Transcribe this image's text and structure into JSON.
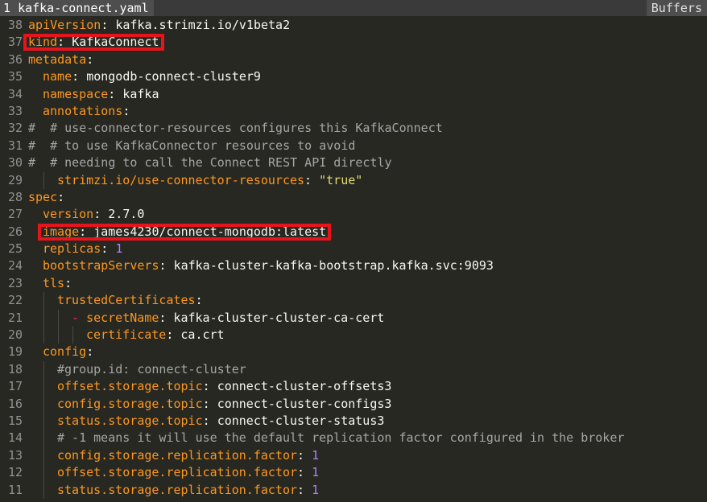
{
  "tabline": {
    "tab_number": "1",
    "tab_filename": "kafka-connect.yaml",
    "right_label": "Buffers"
  },
  "lines": [
    {
      "num": "38",
      "indent": 0,
      "guides": 0,
      "parts": [
        {
          "t": "key",
          "s": "apiVersion"
        },
        {
          "t": "punct",
          "s": ": "
        },
        {
          "t": "val",
          "s": "kafka.strimzi.io/v1beta2"
        }
      ]
    },
    {
      "num": "37",
      "indent": 0,
      "guides": 0,
      "parts": [
        {
          "t": "key",
          "s": "kind"
        },
        {
          "t": "punct",
          "s": ": "
        },
        {
          "t": "val",
          "s": "KafkaConnect"
        }
      ]
    },
    {
      "num": "36",
      "indent": 0,
      "guides": 0,
      "parts": [
        {
          "t": "key",
          "s": "metadata"
        },
        {
          "t": "punct",
          "s": ":"
        }
      ]
    },
    {
      "num": "35",
      "indent": 1,
      "guides": 0,
      "parts": [
        {
          "t": "key",
          "s": "name"
        },
        {
          "t": "punct",
          "s": ": "
        },
        {
          "t": "val",
          "s": "mongodb-connect-cluster9"
        }
      ]
    },
    {
      "num": "34",
      "indent": 1,
      "guides": 0,
      "parts": [
        {
          "t": "key",
          "s": "namespace"
        },
        {
          "t": "punct",
          "s": ": "
        },
        {
          "t": "val",
          "s": "kafka"
        }
      ]
    },
    {
      "num": "33",
      "indent": 1,
      "guides": 0,
      "parts": [
        {
          "t": "key",
          "s": "annotations"
        },
        {
          "t": "punct",
          "s": ":"
        }
      ]
    },
    {
      "num": "32",
      "indent": 0,
      "guides": 0,
      "parts": [
        {
          "t": "cmt",
          "s": "#  # use-connector-resources configures this KafkaConnect"
        }
      ]
    },
    {
      "num": "31",
      "indent": 0,
      "guides": 0,
      "parts": [
        {
          "t": "cmt",
          "s": "#  # to use KafkaConnector resources to avoid"
        }
      ]
    },
    {
      "num": "30",
      "indent": 0,
      "guides": 0,
      "parts": [
        {
          "t": "cmt",
          "s": "#  # needing to call the Connect REST API directly"
        }
      ]
    },
    {
      "num": "29",
      "indent": 2,
      "guides": 1,
      "parts": [
        {
          "t": "key",
          "s": "strimzi.io/use-connector-resources"
        },
        {
          "t": "punct",
          "s": ": "
        },
        {
          "t": "str",
          "s": "\"true\""
        }
      ]
    },
    {
      "num": "28",
      "indent": 0,
      "guides": 0,
      "parts": [
        {
          "t": "key",
          "s": "spec"
        },
        {
          "t": "punct",
          "s": ":"
        }
      ]
    },
    {
      "num": "27",
      "indent": 1,
      "guides": 0,
      "parts": [
        {
          "t": "key",
          "s": "version"
        },
        {
          "t": "punct",
          "s": ": "
        },
        {
          "t": "val",
          "s": "2.7.0"
        }
      ]
    },
    {
      "num": "26",
      "indent": 1,
      "guides": 0,
      "parts": [
        {
          "t": "key",
          "s": "image"
        },
        {
          "t": "punct",
          "s": ": "
        },
        {
          "t": "val",
          "s": "james4230/connect-mongodb:latest"
        }
      ]
    },
    {
      "num": "25",
      "indent": 1,
      "guides": 0,
      "parts": [
        {
          "t": "key",
          "s": "replicas"
        },
        {
          "t": "punct",
          "s": ": "
        },
        {
          "t": "num",
          "s": "1"
        }
      ]
    },
    {
      "num": "24",
      "indent": 1,
      "guides": 0,
      "parts": [
        {
          "t": "key",
          "s": "bootstrapServers"
        },
        {
          "t": "punct",
          "s": ": "
        },
        {
          "t": "val",
          "s": "kafka-cluster-kafka-bootstrap.kafka.svc:9093"
        }
      ]
    },
    {
      "num": "23",
      "indent": 1,
      "guides": 0,
      "parts": [
        {
          "t": "key",
          "s": "tls"
        },
        {
          "t": "punct",
          "s": ":"
        }
      ]
    },
    {
      "num": "22",
      "indent": 2,
      "guides": 1,
      "parts": [
        {
          "t": "key",
          "s": "trustedCertificates"
        },
        {
          "t": "punct",
          "s": ":"
        }
      ]
    },
    {
      "num": "21",
      "indent": 3,
      "guides": 2,
      "parts": [
        {
          "t": "dash",
          "s": "- "
        },
        {
          "t": "key",
          "s": "secretName"
        },
        {
          "t": "punct",
          "s": ": "
        },
        {
          "t": "val",
          "s": "kafka-cluster-cluster-ca-cert"
        }
      ]
    },
    {
      "num": "20",
      "indent": 4,
      "guides": 3,
      "parts": [
        {
          "t": "key",
          "s": "certificate"
        },
        {
          "t": "punct",
          "s": ": "
        },
        {
          "t": "val",
          "s": "ca.crt"
        }
      ]
    },
    {
      "num": "19",
      "indent": 1,
      "guides": 0,
      "parts": [
        {
          "t": "key",
          "s": "config"
        },
        {
          "t": "punct",
          "s": ":"
        }
      ]
    },
    {
      "num": "18",
      "indent": 2,
      "guides": 1,
      "parts": [
        {
          "t": "cmt",
          "s": "#group.id: connect-cluster"
        }
      ]
    },
    {
      "num": "17",
      "indent": 2,
      "guides": 1,
      "parts": [
        {
          "t": "key",
          "s": "offset.storage.topic"
        },
        {
          "t": "punct",
          "s": ": "
        },
        {
          "t": "val",
          "s": "connect-cluster-offsets3"
        }
      ]
    },
    {
      "num": "16",
      "indent": 2,
      "guides": 1,
      "parts": [
        {
          "t": "key",
          "s": "config.storage.topic"
        },
        {
          "t": "punct",
          "s": ": "
        },
        {
          "t": "val",
          "s": "connect-cluster-configs3"
        }
      ]
    },
    {
      "num": "15",
      "indent": 2,
      "guides": 1,
      "parts": [
        {
          "t": "key",
          "s": "status.storage.topic"
        },
        {
          "t": "punct",
          "s": ": "
        },
        {
          "t": "val",
          "s": "connect-cluster-status3"
        }
      ]
    },
    {
      "num": "14",
      "indent": 2,
      "guides": 1,
      "parts": [
        {
          "t": "cmt",
          "s": "# -1 means it will use the default replication factor configured in the broker"
        }
      ]
    },
    {
      "num": "13",
      "indent": 2,
      "guides": 1,
      "parts": [
        {
          "t": "key",
          "s": "config.storage.replication.factor"
        },
        {
          "t": "punct",
          "s": ": "
        },
        {
          "t": "num",
          "s": "1"
        }
      ]
    },
    {
      "num": "12",
      "indent": 2,
      "guides": 1,
      "parts": [
        {
          "t": "key",
          "s": "offset.storage.replication.factor"
        },
        {
          "t": "punct",
          "s": ": "
        },
        {
          "t": "num",
          "s": "1"
        }
      ]
    },
    {
      "num": "11",
      "indent": 2,
      "guides": 1,
      "parts": [
        {
          "t": "key",
          "s": "status.storage.replication.factor"
        },
        {
          "t": "punct",
          "s": ": "
        },
        {
          "t": "num",
          "s": "1"
        }
      ]
    }
  ],
  "highlights": [
    {
      "line": "37",
      "text": "kind: KafkaConnect"
    },
    {
      "line": "26",
      "text": "image: james4230/connect-mongodb:latest"
    }
  ],
  "colors": {
    "background": "#272822",
    "key": "#fd971f",
    "string": "#e6db74",
    "number": "#ae81ff",
    "comment": "#a5a5a5",
    "highlight_box": "#e8141c"
  }
}
